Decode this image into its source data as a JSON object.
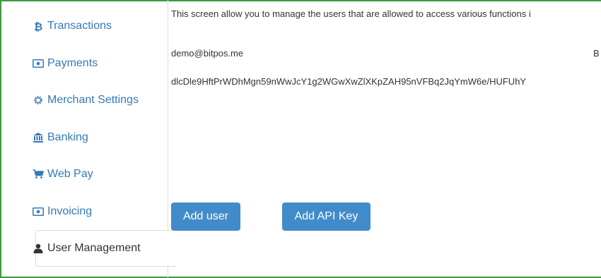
{
  "sidebar": {
    "items": [
      {
        "label": "Transactions",
        "icon": "bitcoin-icon"
      },
      {
        "label": "Payments",
        "icon": "money-icon"
      },
      {
        "label": "Merchant Settings",
        "icon": "gear-icon"
      },
      {
        "label": "Banking",
        "icon": "bank-icon"
      },
      {
        "label": "Web Pay",
        "icon": "shopping-cart-icon"
      },
      {
        "label": "Invoicing",
        "icon": "money-icon"
      },
      {
        "label": "User Management",
        "icon": "user-icon",
        "active": true
      }
    ]
  },
  "main": {
    "intro": "This screen allow you to manage the users that are allowed to access various functions i",
    "user_row": {
      "email": "demo@bitpos.me",
      "role_fragment": "B"
    },
    "api_key": "dlcDle9HftPrWDhMgn59nWwJcY1g2WGwXwZlXKpZAH95nVFBq2JqYmW6e/HUFUhY",
    "buttons": {
      "add_user": "Add user",
      "add_api_key": "Add API Key"
    }
  },
  "colors": {
    "link": "#337ab7",
    "button": "#428bca",
    "frame": "#3d9a3d"
  }
}
